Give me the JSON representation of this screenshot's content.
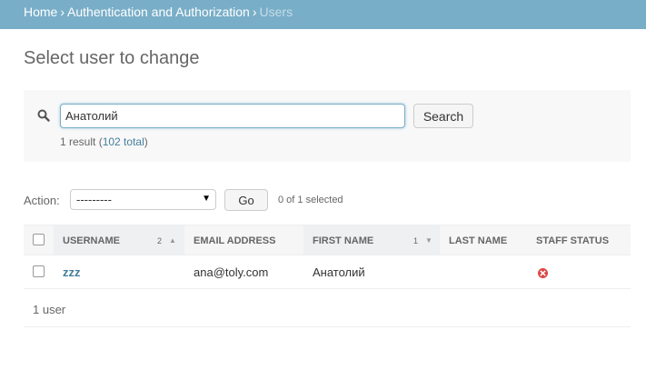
{
  "breadcrumbs": {
    "home": "Home",
    "section": "Authentication and Authorization",
    "current": "Users",
    "separator": "›"
  },
  "page_title": "Select user to change",
  "search": {
    "value": "Анатолий",
    "button_label": "Search",
    "result_count": "1 result",
    "total_link": "102 total"
  },
  "actions": {
    "label": "Action:",
    "selected_option": "---------",
    "go_label": "Go",
    "selection_count": "0 of 1 selected"
  },
  "table": {
    "columns": {
      "username": "Username",
      "username_sort_priority": "2",
      "email": "Email address",
      "first_name": "First name",
      "first_name_sort_priority": "1",
      "last_name": "Last name",
      "staff_status": "Staff status"
    },
    "rows": [
      {
        "username": "zzz",
        "email": "ana@toly.com",
        "first_name": "Анатолий",
        "last_name": "",
        "staff_status": "no"
      }
    ],
    "footer": "1 user"
  },
  "colors": {
    "header_bg": "#79aec8",
    "link": "#447e9b",
    "status_no": "#dd4646"
  }
}
